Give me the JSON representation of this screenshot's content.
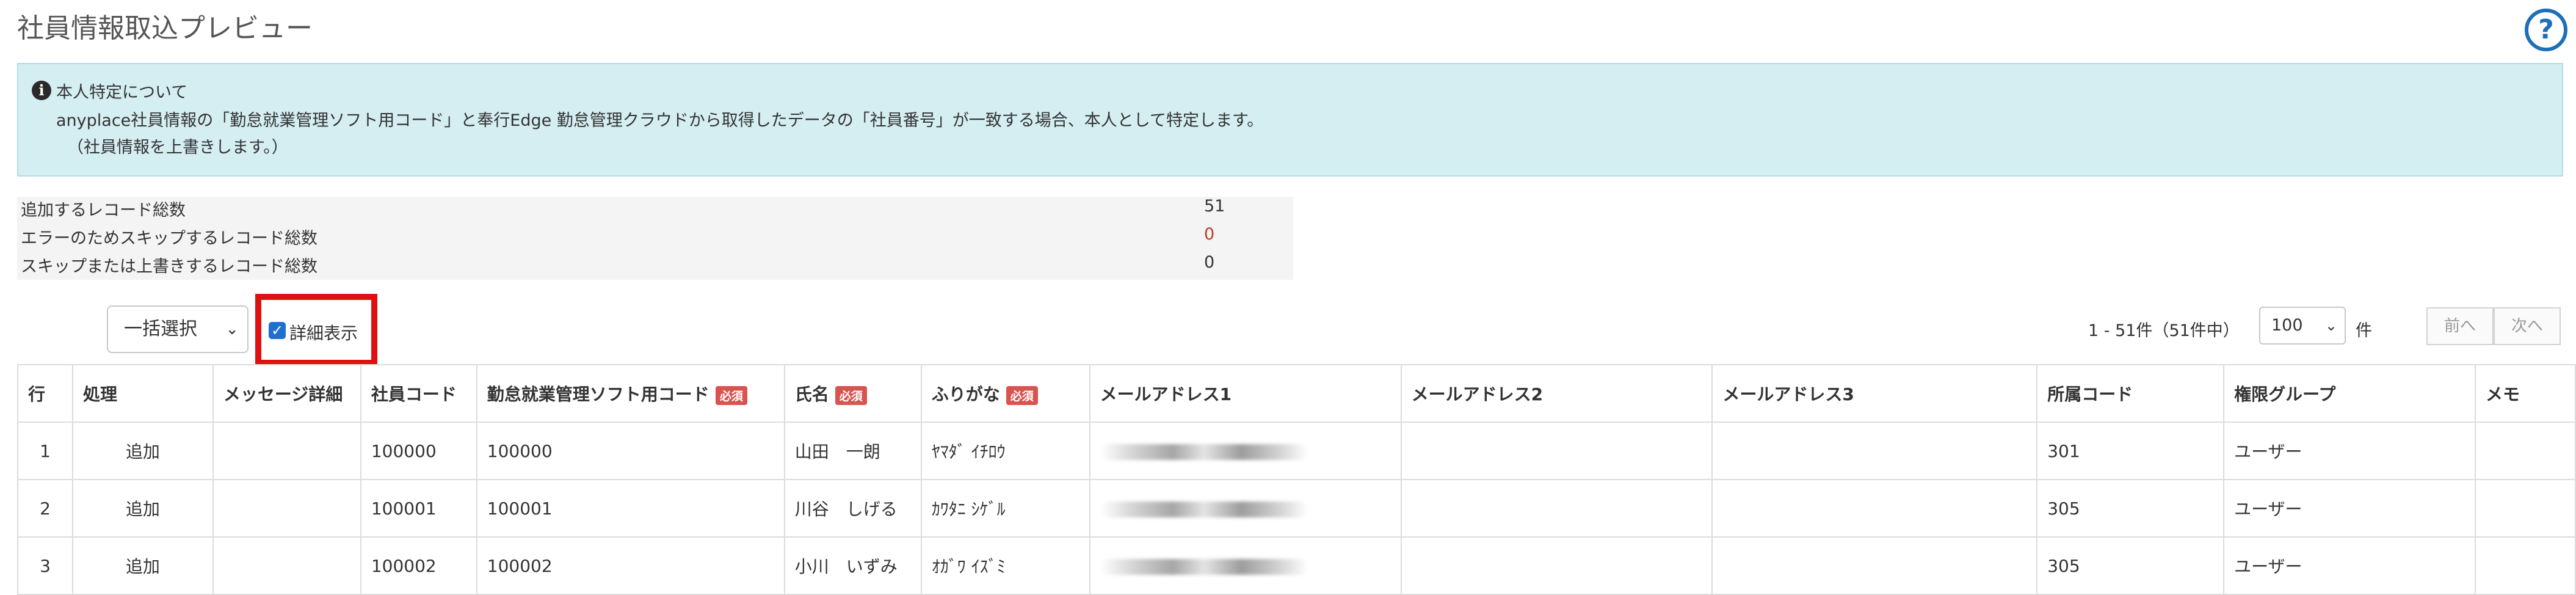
{
  "page": {
    "title": "社員情報取込プレビュー",
    "help_icon": "question-circle-icon"
  },
  "info": {
    "icon": "info-circle-icon",
    "title": "本人特定について",
    "line1": "anyplace社員情報の「勤怠就業管理ソフト用コード」と奉行Edge 勤怠管理クラウドから取得したデータの「社員番号」が一致する場合、本人として特定します。",
    "line2": "（社員情報を上書きします。）"
  },
  "stats": [
    {
      "label": "追加するレコード総数",
      "value": "51"
    },
    {
      "label": "エラーのためスキップするレコード総数",
      "value": "0"
    },
    {
      "label": "スキップまたは上書きするレコード総数",
      "value": "0"
    }
  ],
  "toolbar": {
    "bulk_select": "一括選択",
    "detail_label": "詳細表示",
    "detail_checked": true,
    "range_text": "1 - 51件（51件中）",
    "per_page": "100",
    "per_page_unit": "件",
    "prev": "前へ",
    "next": "次へ"
  },
  "table": {
    "required_badge": "必須",
    "headers": {
      "row": "行",
      "action": "処理",
      "message": "メッセージ詳細",
      "emp_code": "社員コード",
      "att_code": "勤怠就業管理ソフト用コード",
      "name": "氏名",
      "kana": "ふりがな",
      "mail1": "メールアドレス1",
      "mail2": "メールアドレス2",
      "mail3": "メールアドレス3",
      "dept": "所属コード",
      "group": "権限グループ",
      "memo": "メモ"
    },
    "rows": [
      {
        "row": "1",
        "action": "追加",
        "message": "",
        "emp_code": "100000",
        "att_code": "100000",
        "name": "山田　一朗",
        "kana": "ﾔﾏﾀﾞ ｲﾁﾛｳ",
        "mail2": "",
        "mail3": "",
        "dept": "301",
        "group": "ユーザー",
        "memo": ""
      },
      {
        "row": "2",
        "action": "追加",
        "message": "",
        "emp_code": "100001",
        "att_code": "100001",
        "name": "川谷　しげる",
        "kana": "ｶﾜﾀﾆ ｼｹﾞﾙ",
        "mail2": "",
        "mail3": "",
        "dept": "305",
        "group": "ユーザー",
        "memo": ""
      },
      {
        "row": "3",
        "action": "追加",
        "message": "",
        "emp_code": "100002",
        "att_code": "100002",
        "name": "小川　いずみ",
        "kana": "ｵｶﾞﾜ ｲｽﾞﾐ",
        "mail2": "",
        "mail3": "",
        "dept": "305",
        "group": "ユーザー",
        "memo": ""
      }
    ]
  }
}
